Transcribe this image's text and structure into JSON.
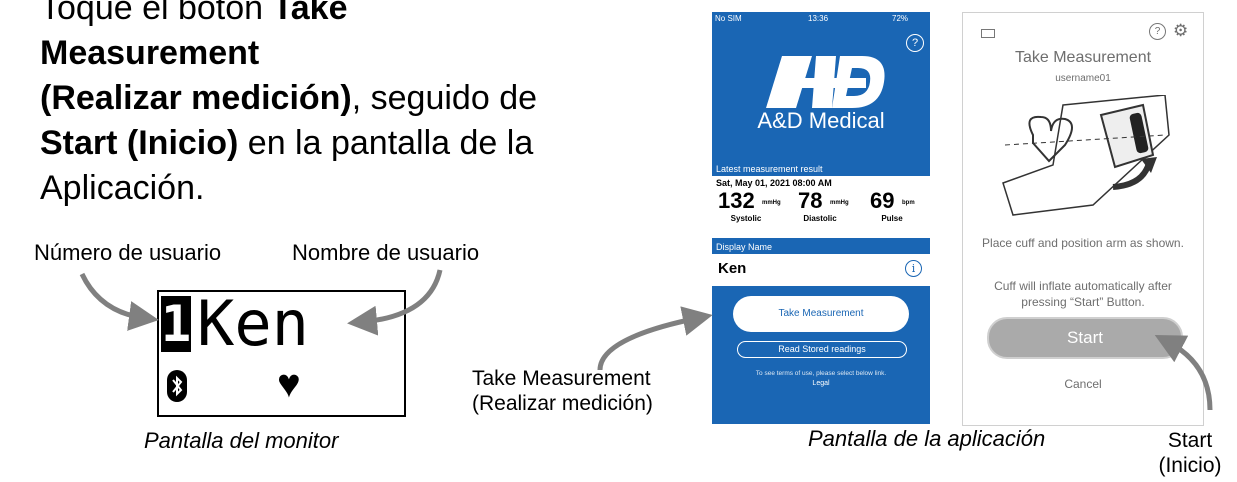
{
  "instruction": {
    "line1_prefix": "Toque el botón ",
    "line1_bold": "Take Measurement",
    "line2_bold": "(Realizar medición)",
    "line2_suffix": ", seguido de",
    "line3_bold": "Start (Inicio)",
    "line3_suffix": " en la pantalla de la",
    "line4": "Aplicación."
  },
  "monitor": {
    "label_user_number": "Número de usuario",
    "label_user_name": "Nombre de usuario",
    "user_number": "1",
    "user_name": "Ken",
    "caption": "Pantalla del monitor",
    "icons": [
      "bluetooth-icon",
      "heart-icon"
    ]
  },
  "app_home": {
    "status_carrier": "No SIM",
    "status_time": "13:36",
    "status_battery": "72%",
    "brand": "A&D Medical",
    "latest_label": "Latest measurement result",
    "date": "Sat, May 01, 2021 08:00 AM",
    "systolic": {
      "value": "132",
      "unit": "mmHg",
      "label": "Systolic"
    },
    "diastolic": {
      "value": "78",
      "unit": "mmHg",
      "label": "Diastolic"
    },
    "pulse": {
      "value": "69",
      "unit": "bpm",
      "label": "Pulse"
    },
    "display_name_label": "Display Name",
    "display_name": "Ken",
    "take_measurement": "Take Measurement",
    "read_stored": "Read Stored readings",
    "terms": "To see terms of use, please select below link.",
    "legal": "Legal",
    "colors": {
      "primary": "#1a66b4"
    }
  },
  "callout_take": {
    "line1": "Take Measurement",
    "line2": "(Realizar medición)"
  },
  "app_measure": {
    "title": "Take Measurement",
    "username": "username01",
    "msg1": "Place cuff and position arm as shown.",
    "msg2": "Cuff will inflate automatically after pressing “Start” Button.",
    "start": "Start",
    "cancel": "Cancel"
  },
  "caption_app": "Pantalla de la aplicación",
  "callout_start": {
    "line1": "Start",
    "line2": "(Inicio)"
  }
}
